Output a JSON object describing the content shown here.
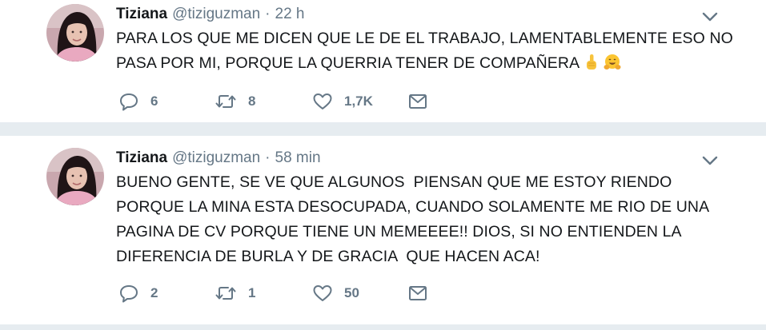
{
  "colors": {
    "page_background": "#e6ecf0",
    "card_background": "#ffffff",
    "text_primary": "#14171a",
    "text_secondary": "#657786"
  },
  "icons": {
    "reply": "reply-icon",
    "retweet": "retweet-icon",
    "like": "heart-icon",
    "dm": "envelope-icon",
    "menu": "chevron-down-icon"
  },
  "tweets": [
    {
      "author_name": "Tiziana",
      "handle": "@tiziguzman",
      "separator": "·",
      "time": "22 h",
      "text_lines": [
        "PARA LOS QUE ME DICEN QUE LE DE EL TRABAJO, LAMENTABLEMENTE ESO NO",
        "PASA POR MI, PORQUE LA QUERRIA TENER DE COMPAÑERA"
      ],
      "emojis": [
        "pointing-up-emoji",
        "hugging-face-emoji"
      ],
      "replies": "6",
      "retweets": "8",
      "likes": "1,7K"
    },
    {
      "author_name": "Tiziana",
      "handle": "@tiziguzman",
      "separator": "·",
      "time": "58 min",
      "text_lines": [
        "BUENO GENTE, SE VE QUE ALGUNOS  PIENSAN QUE ME ESTOY RIENDO",
        "PORQUE LA MINA ESTA DESOCUPADA, CUANDO SOLAMENTE ME RIO DE UNA",
        "PAGINA DE CV PORQUE TIENE UN MEMEEEE!! DIOS, SI NO ENTIENDEN LA",
        "DIFERENCIA DE BURLA Y DE GRACIA  QUE HACEN ACA!"
      ],
      "replies": "2",
      "retweets": "1",
      "likes": "50"
    }
  ]
}
